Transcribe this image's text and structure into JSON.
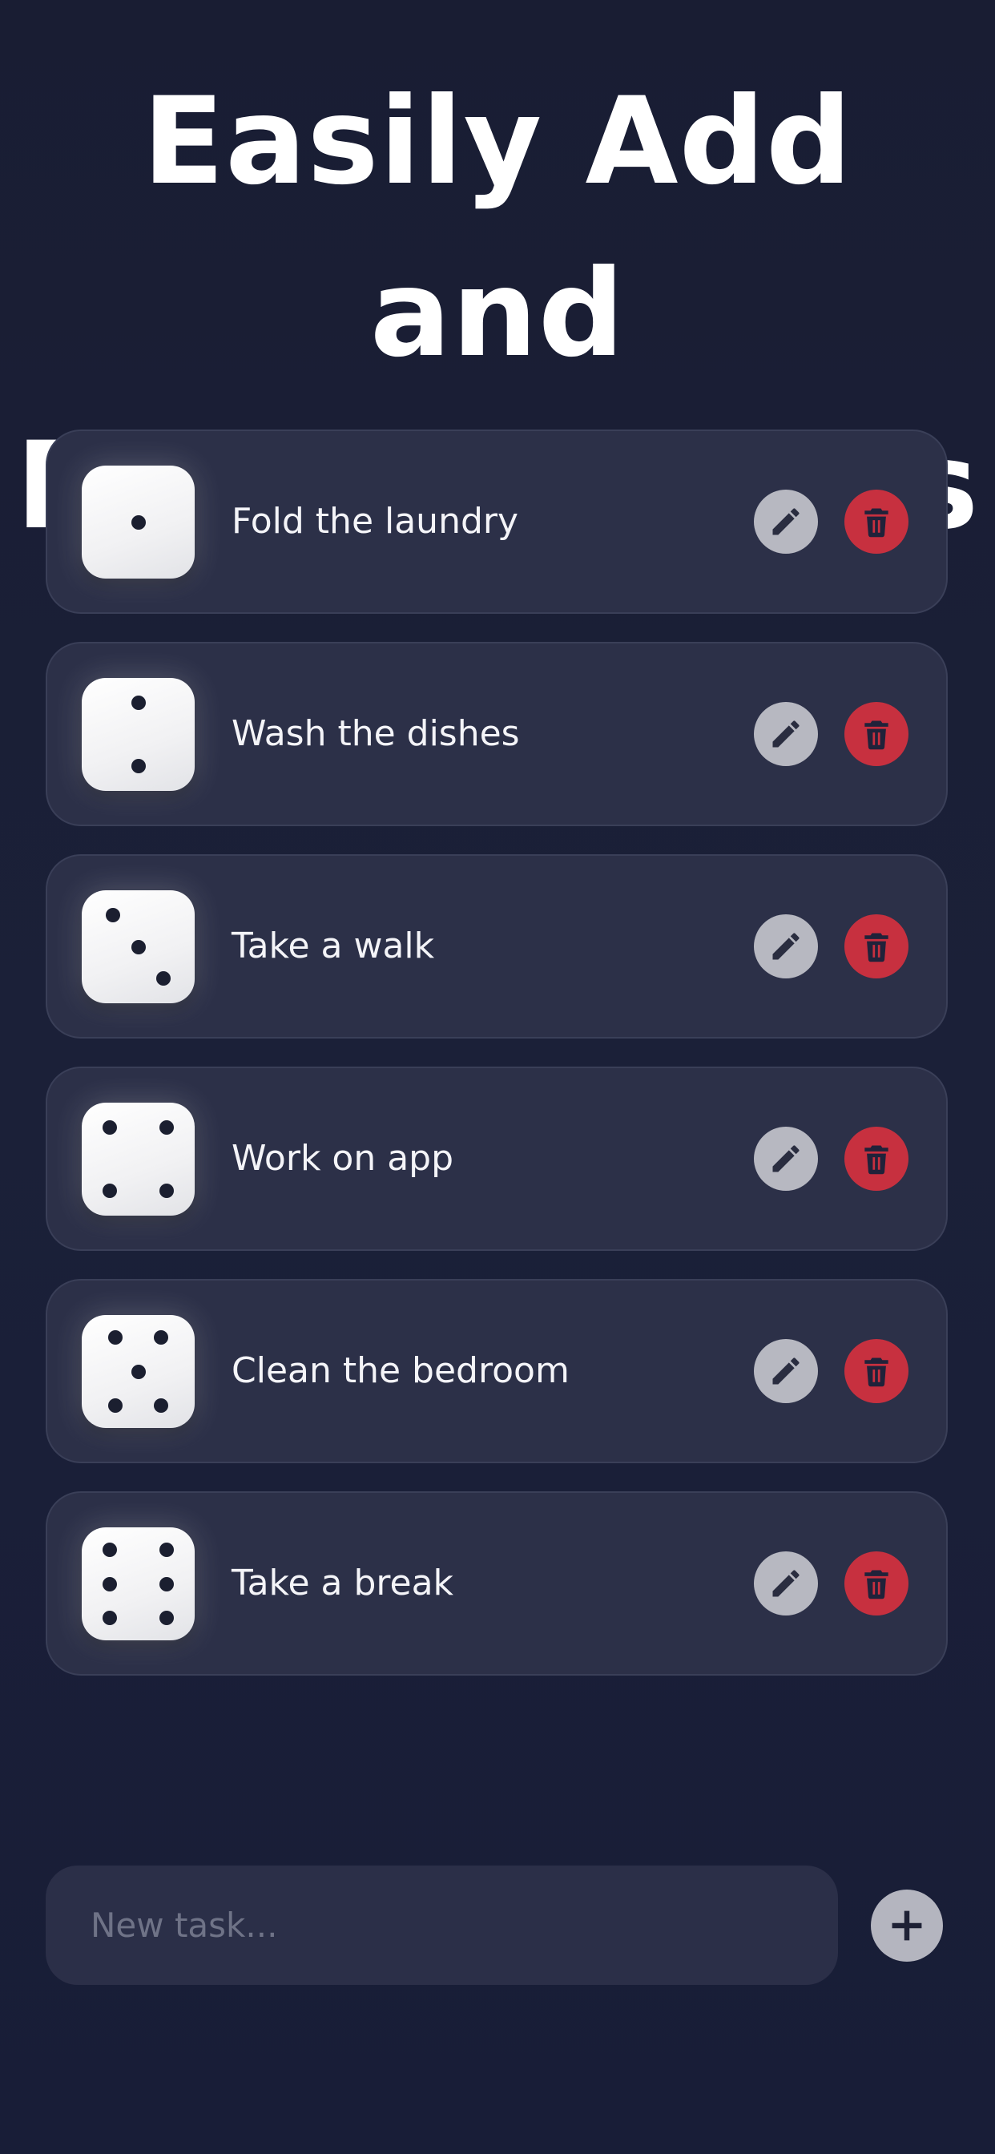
{
  "headline": {
    "line1": "Easily Add and",
    "line2": "Remove Tasks"
  },
  "colors": {
    "background": "#1a1f37",
    "card": "#2c3048",
    "edit_button": "#b7b8c1",
    "delete_button": "#c7303f",
    "text": "#f4f4f8"
  },
  "tasks": [
    {
      "label": "Fold the laundry",
      "die_value": 1,
      "edit_icon": "pencil-icon",
      "delete_icon": "trash-icon"
    },
    {
      "label": "Wash the dishes",
      "die_value": 2,
      "edit_icon": "pencil-icon",
      "delete_icon": "trash-icon"
    },
    {
      "label": "Take a walk",
      "die_value": 3,
      "edit_icon": "pencil-icon",
      "delete_icon": "trash-icon"
    },
    {
      "label": "Work on app",
      "die_value": 4,
      "edit_icon": "pencil-icon",
      "delete_icon": "trash-icon"
    },
    {
      "label": "Clean the bedroom",
      "die_value": 5,
      "edit_icon": "pencil-icon",
      "delete_icon": "trash-icon"
    },
    {
      "label": "Take a break",
      "die_value": 6,
      "edit_icon": "pencil-icon",
      "delete_icon": "trash-icon"
    }
  ],
  "composer": {
    "value": "",
    "placeholder": "New task...",
    "add_icon": "plus-icon"
  }
}
